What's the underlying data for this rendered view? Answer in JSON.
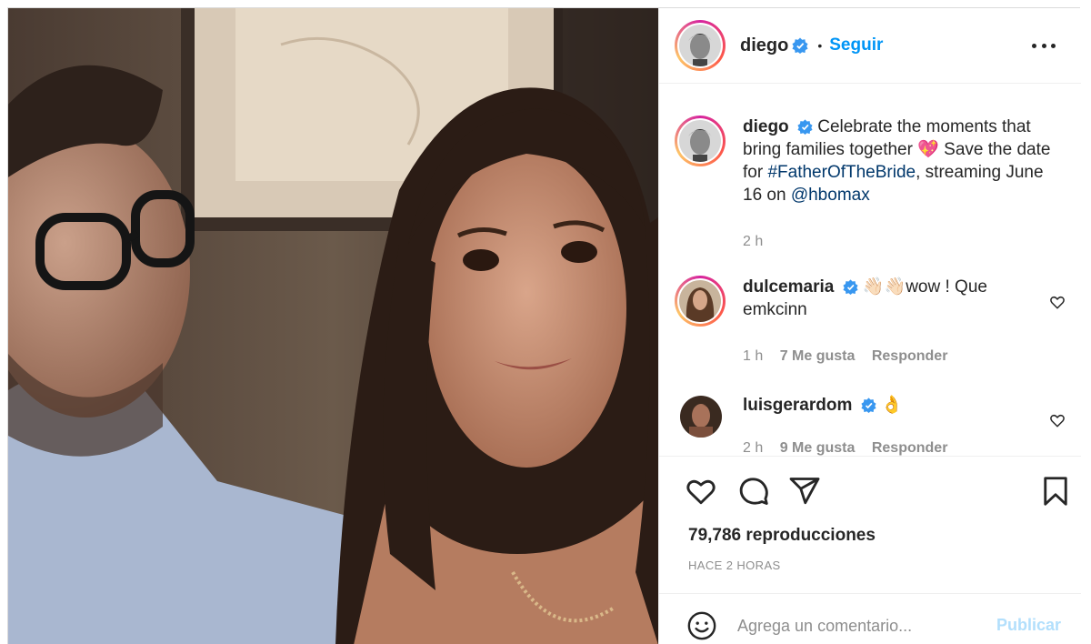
{
  "post": {
    "author": "diego",
    "dot": "•",
    "follow_label": "Seguir",
    "more_icon": "more-horizontal-icon"
  },
  "caption": {
    "user": "diego",
    "text_before": "Celebrate the moments that bring families together",
    "emoji": "💖",
    "text_middle": "Save the date for",
    "hashtag": "#FatherOfTheBride",
    "text_after": ", streaming June 16 on",
    "mention": "@hbomax",
    "time": "2 h"
  },
  "comments": [
    {
      "user": "dulcemaria",
      "text": "👋🏻👋🏻wow ! Que emkcinn",
      "time": "1 h",
      "likes": "7 Me gusta",
      "reply": "Responder"
    },
    {
      "user": "luisgerardom",
      "text": "👌",
      "time": "2 h",
      "likes": "9 Me gusta",
      "reply": "Responder"
    }
  ],
  "stats": {
    "views": "79,786 reproducciones",
    "posted": "HACE 2 HORAS"
  },
  "composer": {
    "placeholder": "Agrega un comentario...",
    "publish": "Publicar"
  },
  "colors": {
    "accent": "#0095f6",
    "publish_disabled": "#b2dffc",
    "text": "#262626",
    "muted": "#8e8e8e",
    "link": "#00376b"
  }
}
